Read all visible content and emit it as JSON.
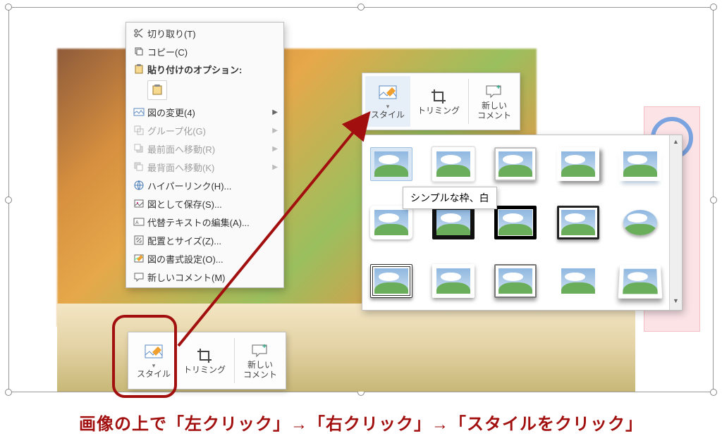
{
  "context_menu": {
    "cut": "切り取り(T)",
    "copy": "コピー(C)",
    "paste_options_header": "貼り付けのオプション:",
    "change_picture": "図の変更(4)",
    "group": "グループ化(G)",
    "bring_front": "最前面へ移動(R)",
    "send_back": "最背面へ移動(K)",
    "hyperlink": "ハイパーリンク(H)...",
    "save_as_picture": "図として保存(S)...",
    "edit_alt_text": "代替テキストの編集(A)...",
    "size_position": "配置とサイズ(Z)...",
    "format_picture": "図の書式設定(O)...",
    "new_comment": "新しいコメント(M)"
  },
  "mini_toolbar": {
    "style": "スタイル",
    "crop": "トリミング",
    "new_comment_line1": "新しい",
    "new_comment_line2": "コメント"
  },
  "tooltip": "シンプルな枠、白",
  "caption": "画像の上で「左クリック」→「右クリック」→「スタイルをクリック」"
}
